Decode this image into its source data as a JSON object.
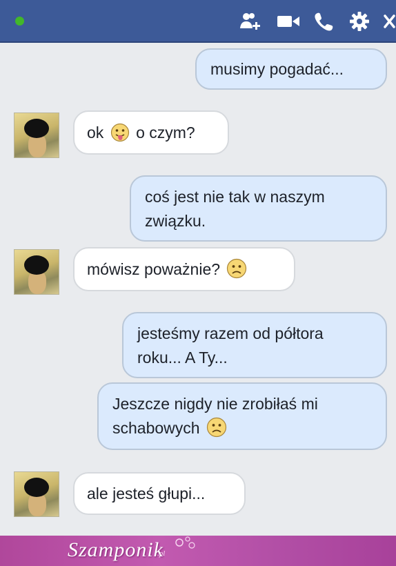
{
  "header": {
    "status": "online",
    "icons": [
      "add-friend-icon",
      "video-call-icon",
      "phone-icon",
      "gear-icon",
      "close-icon"
    ]
  },
  "messages": [
    {
      "id": "m1",
      "side": "out",
      "text": "musimy pogadać..."
    },
    {
      "id": "m2",
      "side": "in",
      "text_before": "ok",
      "emoji": "tongue-emoji",
      "text_after": "o czym?"
    },
    {
      "id": "m3",
      "side": "out",
      "line1": "coś jest nie tak w naszym",
      "line2": "związku."
    },
    {
      "id": "m4",
      "side": "in",
      "text_before": "mówisz poważnie?",
      "emoji": "sad-emoji"
    },
    {
      "id": "m5",
      "side": "out",
      "line1": "jesteśmy razem od półtora",
      "line2": "roku... A Ty..."
    },
    {
      "id": "m6",
      "side": "out",
      "line1": "Jeszcze nigdy nie zrobiłaś mi",
      "line2": "schabowych",
      "emoji": "sad-emoji"
    },
    {
      "id": "m7",
      "side": "in",
      "text": "ale jesteś głupi..."
    }
  ],
  "footer": {
    "watermark": "Szamponik",
    "watermark_suffix": ".pl"
  },
  "colors": {
    "header_bg": "#3d5a98",
    "chat_bg": "#e9ebee",
    "outgoing_bubble": "#dbeafd",
    "incoming_bubble": "#ffffff",
    "footer_bg": "#b24fa6"
  }
}
